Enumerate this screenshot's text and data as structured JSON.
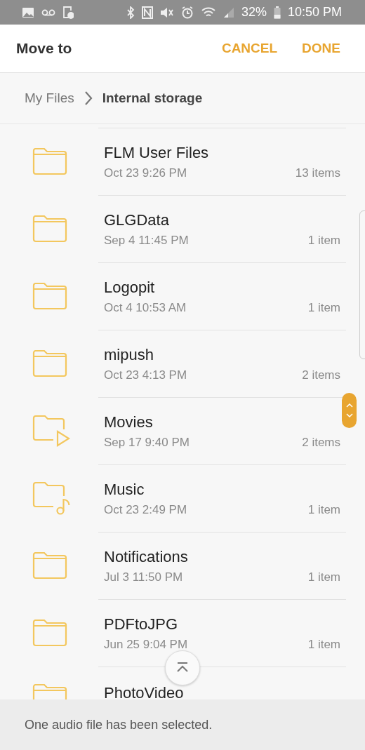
{
  "status_bar": {
    "battery": "32%",
    "time": "10:50 PM"
  },
  "header": {
    "title": "Move to",
    "actions": [
      "CANCEL",
      "DONE"
    ]
  },
  "breadcrumb": [
    {
      "label": "My Files",
      "selected": false
    },
    {
      "label": "Internal storage",
      "selected": true
    }
  ],
  "folders": [
    {
      "kind": "folder",
      "name": "FLM User Files",
      "date": "Oct 23 9:26 PM",
      "count": "13 items"
    },
    {
      "kind": "folder",
      "name": "GLGData",
      "date": "Sep 4 11:45 PM",
      "count": "1 item"
    },
    {
      "kind": "folder",
      "name": "Logopit",
      "date": "Oct 4 10:53 AM",
      "count": "1 item"
    },
    {
      "kind": "folder",
      "name": "mipush",
      "date": "Oct 23 4:13 PM",
      "count": "2 items"
    },
    {
      "kind": "video",
      "name": "Movies",
      "date": "Sep 17 9:40 PM",
      "count": "2 items"
    },
    {
      "kind": "music",
      "name": "Music",
      "date": "Oct 23 2:49 PM",
      "count": "1 item"
    },
    {
      "kind": "folder",
      "name": "Notifications",
      "date": "Jul 3 11:50 PM",
      "count": "1 item"
    },
    {
      "kind": "folder",
      "name": "PDFtoJPG",
      "date": "Jun 25 9:04 PM",
      "count": "1 item"
    },
    {
      "kind": "folder",
      "name": "PhotoVideo"
    }
  ],
  "footer": {
    "message": "One audio file has been selected."
  }
}
